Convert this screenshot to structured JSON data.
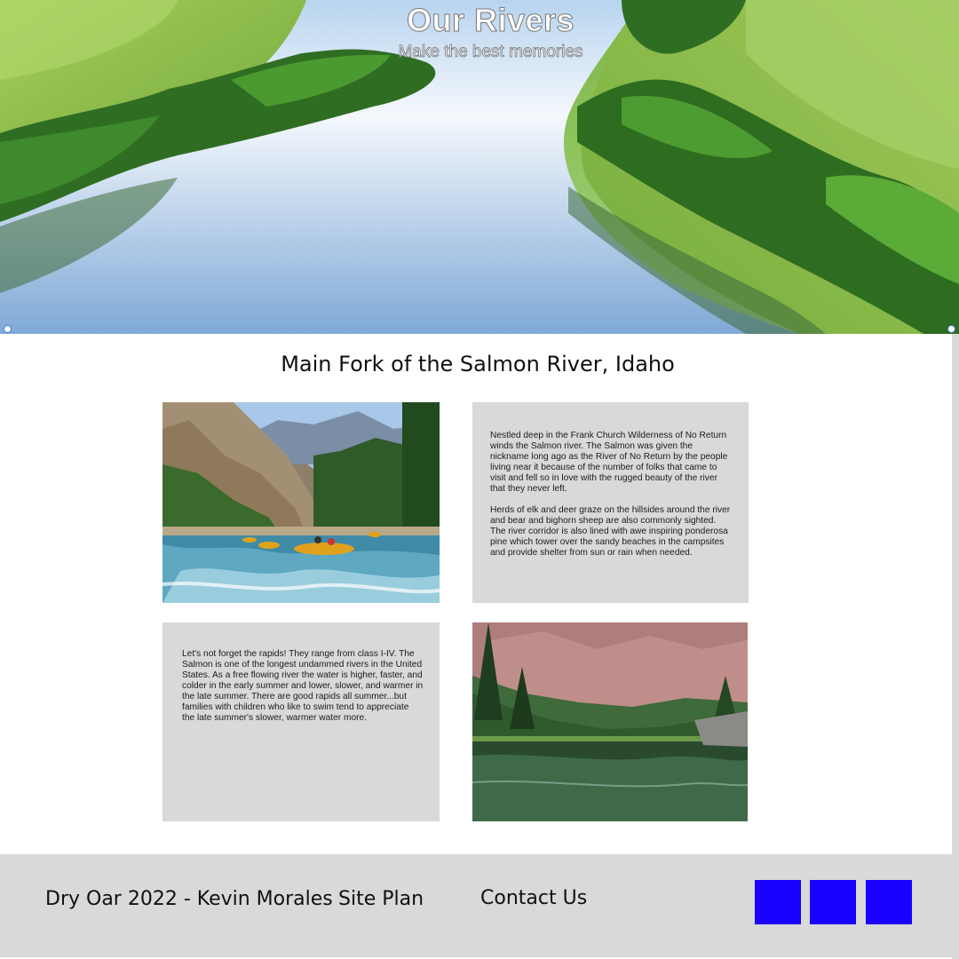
{
  "hero": {
    "title": "Our Rivers",
    "subtitle": "Make the best memories"
  },
  "main": {
    "title": "Main Fork of the Salmon River, Idaho",
    "intro_paragraphs": [
      "Nestled deep in the Frank Church Wilderness of No Return winds the Salmon river. The Salmon was given the nickname long ago as the River of No Return by the people living near it because of the number of folks that came to visit and fell so in love with the rugged beauty of the river that they never left.",
      "Herds of elk and deer graze on the hillsides around the river and bear and bighorn sheep are also commonly sighted. The river corridor is also lined with awe inspiring ponderosa pine which tower over the sandy beaches in the campsites and provide shelter from sun or rain when needed."
    ],
    "rapids_text": "Let's not forget the rapids! They range from class I-IV. The Salmon is one of the longest undammed rivers in the United States. As a free flowing river the water is higher, faster, and colder in the early summer and lower, slower, and warmer in the late summer. There are good rapids all summer...but families with children who like to swim tend to appreciate the late summer's slower, warmer water more."
  },
  "footer": {
    "copyright": "Dry Oar 2022 - Kevin Morales",
    "site_plan": "Site Plan",
    "contact": "Contact Us"
  },
  "colors": {
    "social_blue": "#1a00ff",
    "panel_gray": "#d9d9d9"
  }
}
